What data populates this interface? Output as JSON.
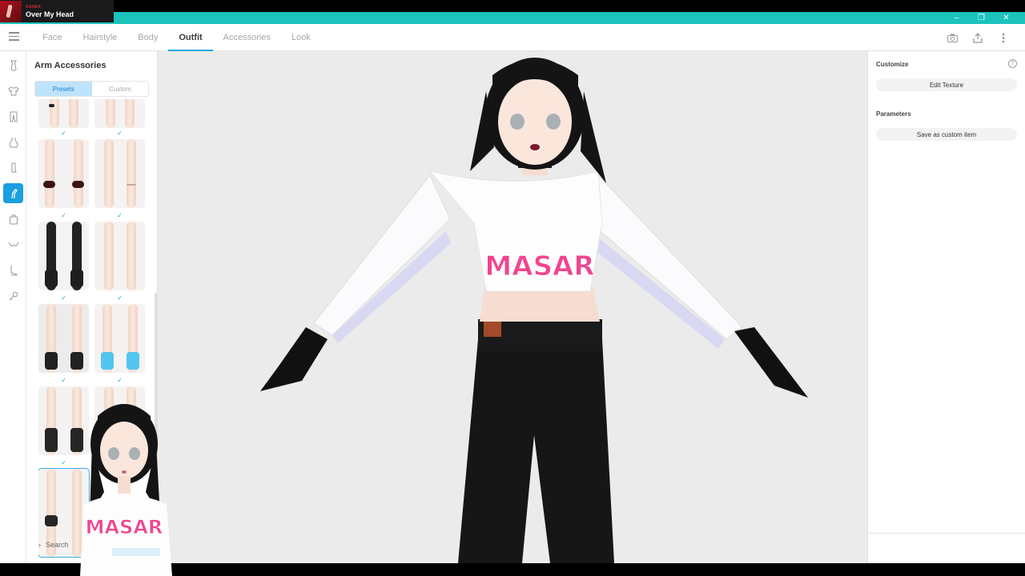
{
  "now_playing": {
    "artist": "ASHER",
    "title": "Over My Head"
  },
  "window": {
    "controls": [
      "–",
      "❐",
      "✕"
    ]
  },
  "topnav": {
    "tabs": [
      {
        "label": "Face"
      },
      {
        "label": "Hairstyle"
      },
      {
        "label": "Body"
      },
      {
        "label": "Outfit",
        "active": true
      },
      {
        "label": "Accessories"
      },
      {
        "label": "Look"
      }
    ],
    "icons": [
      "camera-icon",
      "share-icon",
      "more-icon"
    ]
  },
  "rail": {
    "items": [
      "tie-icon",
      "shirt-icon",
      "pants-icon",
      "onepiece-icon",
      "socks-icon",
      "arm-accessory-icon",
      "bag-icon",
      "bra-icon",
      "shoes-icon",
      "key-icon"
    ],
    "active_index": 5
  },
  "panel": {
    "title": "Arm Accessories",
    "segments": [
      "Presets",
      "Custom"
    ],
    "active_segment": "Presets",
    "check_glyph": "✓",
    "search_label": "Search"
  },
  "right": {
    "customize_label": "Customize",
    "edit_texture_label": "Edit Texture",
    "parameters_label": "Parameters",
    "save_custom_label": "Save as custom item",
    "help_glyph": "?"
  },
  "shirt_text": "MASAR",
  "colors": {
    "accent": "#1aa7d6",
    "titlebar": "#1cc3bd",
    "segment_active": "#bfe3fb",
    "shirt_text": "#f0458f"
  }
}
